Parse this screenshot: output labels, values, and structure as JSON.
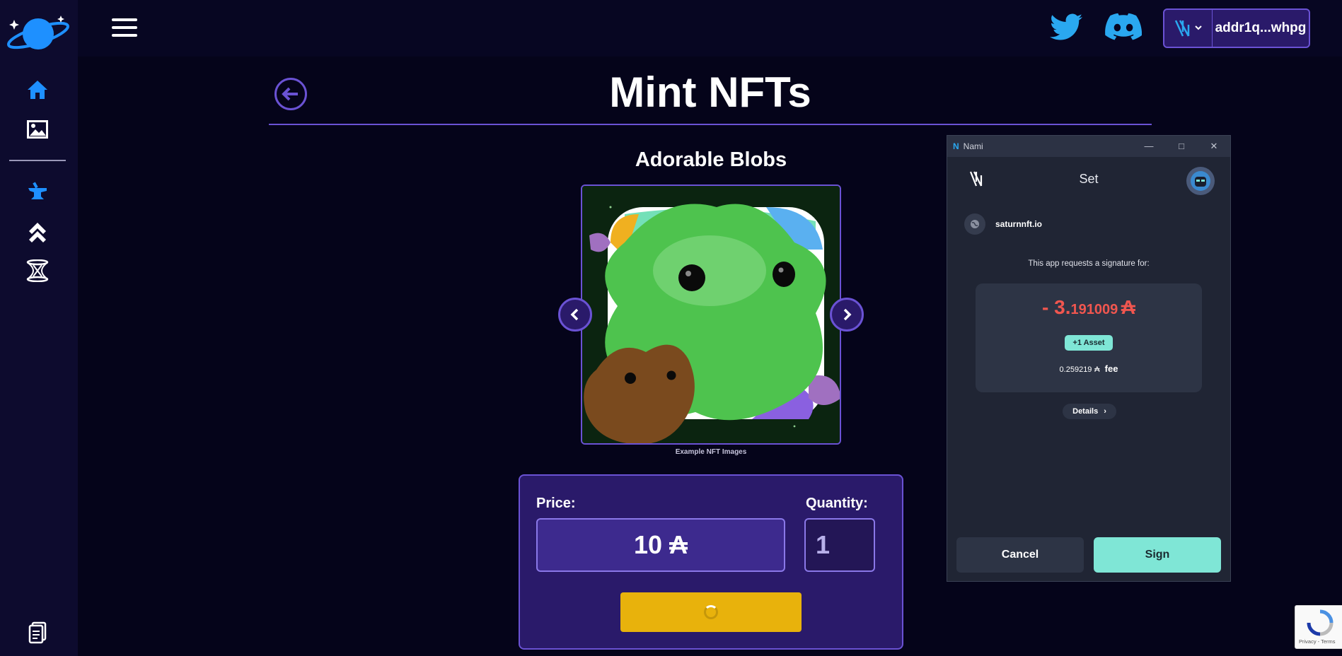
{
  "header": {
    "wallet_address": "addr1q...whpg"
  },
  "sidebar": {
    "icons": [
      "home-icon",
      "image-icon",
      "anvil-icon",
      "chevrons-up-icon",
      "hourglass-icon",
      "document-icon"
    ]
  },
  "main": {
    "title": "Mint NFTs",
    "collection_title": "Adorable Blobs",
    "image_caption": "Example NFT Images",
    "price_label": "Price:",
    "price_value": "10 ₳",
    "quantity_label": "Quantity:",
    "quantity_value": "1"
  },
  "nami": {
    "window_title": "Nami",
    "header_title": "Set",
    "site": "saturnnft.io",
    "request_text": "This app requests a signature for:",
    "amount_prefix": "- 3.",
    "amount_decimals": "191009",
    "currency_symbol": "₳",
    "asset_badge": "+1 Asset",
    "fee_value": "0.259219",
    "fee_currency": "₳",
    "fee_label": "fee",
    "details_label": "Details",
    "cancel_label": "Cancel",
    "sign_label": "Sign"
  },
  "recaptcha": {
    "text": "Privacy - Terms"
  },
  "colors": {
    "accent": "#6a52d4",
    "panel": "#2a1a6a",
    "mint_button": "#e8b20c",
    "nami_sign": "#7fe6d6",
    "amount": "#f0564f"
  }
}
